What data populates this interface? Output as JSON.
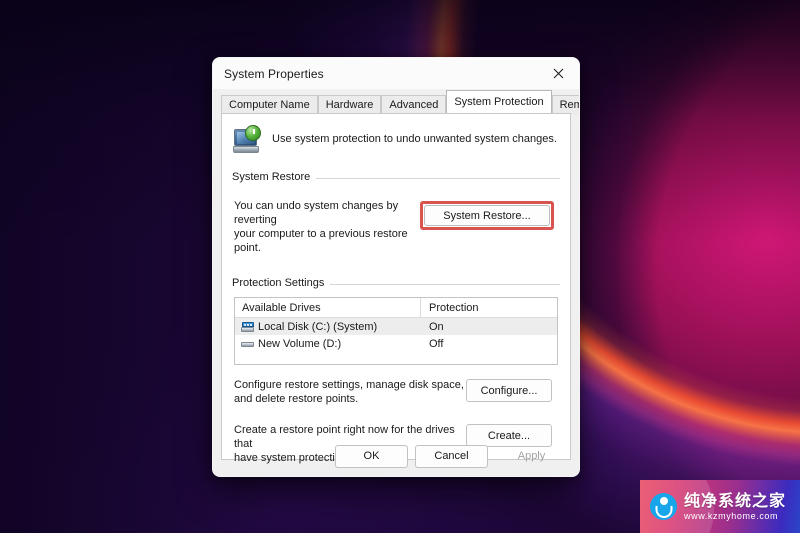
{
  "desktop": {
    "wallpaper_name": "windows-11-bloom-wallpaper",
    "colors": {
      "deep_purple": "#170634",
      "magenta": "#d61878",
      "violet": "#7c2ee0",
      "arc_orange": "#ff5630"
    }
  },
  "dialog": {
    "title": "System Properties",
    "close_icon": "close-icon",
    "tabs": [
      {
        "label": "Computer Name",
        "active": false
      },
      {
        "label": "Hardware",
        "active": false
      },
      {
        "label": "Advanced",
        "active": false
      },
      {
        "label": "System Protection",
        "active": true
      },
      {
        "label": "Remote",
        "active": false
      }
    ],
    "header": {
      "icon": "computer-shield-icon",
      "text": "Use system protection to undo unwanted system changes."
    },
    "system_restore": {
      "group_title": "System Restore",
      "description_line1": "You can undo system changes by reverting",
      "description_line2": "your computer to a previous restore point.",
      "button_label": "System Restore...",
      "button_highlight_color": "#d9534f"
    },
    "protection_settings": {
      "group_title": "Protection Settings",
      "columns": [
        "Available Drives",
        "Protection"
      ],
      "rows": [
        {
          "drive": "Local Disk (C:) (System)",
          "protection": "On",
          "icon": "system-drive-icon",
          "selected": true
        },
        {
          "drive": "New Volume (D:)",
          "protection": "Off",
          "icon": "drive-icon",
          "selected": false
        }
      ],
      "configure": {
        "description_line1": "Configure restore settings, manage disk space,",
        "description_line2": "and delete restore points.",
        "button_label": "Configure..."
      },
      "create": {
        "description_line1": "Create a restore point right now for the drives that",
        "description_line2": "have system protection turned on.",
        "button_label": "Create..."
      }
    },
    "footer": {
      "ok_label": "OK",
      "cancel_label": "Cancel",
      "apply_label": "Apply",
      "apply_disabled": true
    }
  },
  "watermark": {
    "brand_cn": "纯净系统之家",
    "url": "www.kzmyhome.com",
    "logo_icon": "kzmyhome-logo-icon"
  }
}
